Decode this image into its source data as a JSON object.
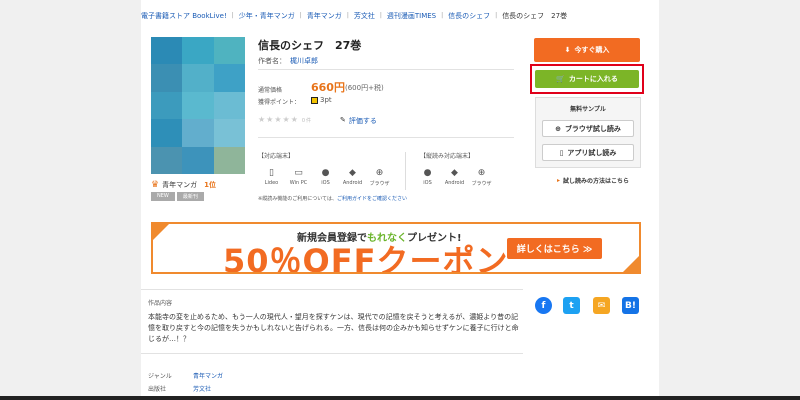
{
  "breadcrumb": [
    "電子書籍ストア BookLive!",
    "少年・青年マンガ",
    "青年マンガ",
    "芳文社",
    "週刊漫画TIMES",
    "信長のシェフ",
    "信長のシェフ　27巻"
  ],
  "cover_colors": [
    "#2b8ab5",
    "#3aa7c4",
    "#4fb3c0",
    "#3b8fb3",
    "#52b0c9",
    "#3ea1c6",
    "#3c9bbd",
    "#5ab9cf",
    "#6bbcd3",
    "#2e8fb8",
    "#62aecd",
    "#79c1d6",
    "#4b93b0",
    "#3d93bb",
    "#8fb59a"
  ],
  "ranking": {
    "category": "青年マンガ",
    "position": "1位"
  },
  "badges": [
    "NEW",
    "最新刊"
  ],
  "book": {
    "title": "信長のシェフ　27巻",
    "author_label": "作者名：",
    "author": "梶川卓郎",
    "price_label": "通常価格",
    "price": "660円",
    "price_tax": "(600円+税)",
    "points_label": "獲得ポイント：",
    "points": "3pt",
    "rating_stars": "★★★★★",
    "rating_count": "0件",
    "review_link": "評価する"
  },
  "devices": {
    "supported_label": "【対応端末】",
    "supported": [
      {
        "icon": "tablet-icon",
        "glyph": "▯",
        "label": "Lideo"
      },
      {
        "icon": "monitor-icon",
        "glyph": "▭",
        "label": "Win PC"
      },
      {
        "icon": "apple-icon",
        "glyph": "●",
        "label": "iOS"
      },
      {
        "icon": "android-icon",
        "glyph": "◆",
        "label": "Android"
      },
      {
        "icon": "globe-icon",
        "glyph": "⊕",
        "label": "ブラウザ"
      }
    ],
    "vertical_label": "【縦読み対応端末】",
    "vertical": [
      {
        "icon": "apple-icon",
        "glyph": "●",
        "label": "iOS"
      },
      {
        "icon": "android-icon",
        "glyph": "◆",
        "label": "Android"
      },
      {
        "icon": "globe-icon",
        "glyph": "⊕",
        "label": "ブラウザ"
      }
    ],
    "notice_text": "※縦読み機能のご利用については、",
    "notice_link": "ご利用ガイドをご確認ください"
  },
  "actions": {
    "buy_label": "今すぐ購入",
    "cart_label": "カートに入れる",
    "sample_title": "無料サンプル",
    "browser_label": "ブラウザ試し読み",
    "app_label": "アプリ試し読み",
    "sample_help": "試し読みの方法はこちら"
  },
  "banner": {
    "line1_a": "新規会員登録で",
    "line1_green": "もれなく",
    "line1_b": "プレゼント!",
    "big": "50％OFFクーポン",
    "button": "詳しくはこちら ≫"
  },
  "description": {
    "heading": "作品内容",
    "text_a": "本能寺の変を止めるため、もう一人の現代人・望月を探すケンは、現代での記憶を戻そうと考えるが、濃姫より昔の記憶を取り戻すと今の記憶を失うかもしれないと告げられる。一方、信長は何の企みかも知らせずケンに養子に行けと命じるが…！？"
  },
  "share": [
    "f",
    "t",
    "✉",
    "B!"
  ],
  "meta": [
    {
      "key": "ジャンル",
      "value": "青年マンガ"
    },
    {
      "key": "出版社",
      "value": "芳文社"
    }
  ]
}
